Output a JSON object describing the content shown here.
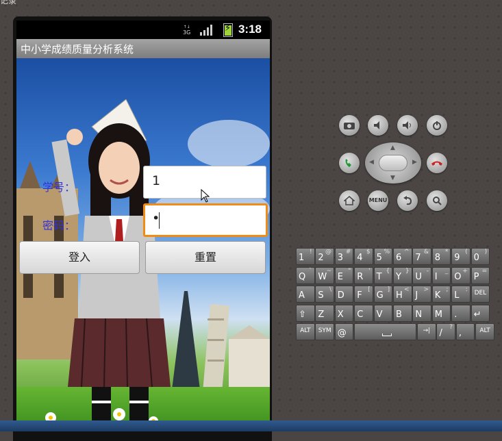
{
  "window": {
    "title": "记录"
  },
  "status_bar": {
    "network": "3G",
    "time": "3:18"
  },
  "app": {
    "title": "中小学成绩质量分析系统"
  },
  "form": {
    "student_id_label": "学号：",
    "student_id_value": "1",
    "password_label": "密码：",
    "password_value": "•",
    "login_button": "登入",
    "reset_button": "重置"
  },
  "controls": {
    "camera": "camera-icon",
    "volume_down": "volume-down-icon",
    "volume_up": "volume-up-icon",
    "power": "power-icon",
    "call": "call-icon",
    "end_call": "end-call-icon",
    "home": "home-icon",
    "menu_label": "MENU",
    "back": "back-icon",
    "search": "search-icon"
  },
  "keyboard": {
    "row1": [
      [
        "1",
        "!"
      ],
      [
        "2",
        "@"
      ],
      [
        "3",
        "#"
      ],
      [
        "4",
        "$"
      ],
      [
        "5",
        "%"
      ],
      [
        "6",
        "^"
      ],
      [
        "7",
        "&"
      ],
      [
        "8",
        "*"
      ],
      [
        "9",
        "("
      ],
      [
        "0",
        ")"
      ]
    ],
    "row2": [
      [
        "Q",
        "`"
      ],
      [
        "W",
        "~"
      ],
      [
        "E",
        "\""
      ],
      [
        "R",
        "'"
      ],
      [
        "T",
        "{"
      ],
      [
        "Y",
        "}"
      ],
      [
        "U",
        "-"
      ],
      [
        "I",
        "_"
      ],
      [
        "O",
        "+"
      ],
      [
        "P",
        "="
      ]
    ],
    "row3": [
      [
        "A",
        ""
      ],
      [
        "S",
        "\\"
      ],
      [
        "D",
        ""
      ],
      [
        "F",
        "["
      ],
      [
        "G",
        "]"
      ],
      [
        "H",
        "<"
      ],
      [
        "J",
        ">"
      ],
      [
        "K",
        ";"
      ],
      [
        "L",
        ":"
      ],
      [
        "DEL",
        ""
      ]
    ],
    "row4": [
      [
        "⇧",
        ""
      ],
      [
        "Z",
        ""
      ],
      [
        "X",
        ""
      ],
      [
        "C",
        ""
      ],
      [
        "V",
        ""
      ],
      [
        "B",
        ""
      ],
      [
        "N",
        ""
      ],
      [
        "M",
        ""
      ],
      [
        ".",
        ""
      ],
      [
        "↵",
        ""
      ]
    ],
    "row5": [
      [
        "ALT",
        ""
      ],
      [
        "SYM",
        ""
      ],
      [
        "@",
        ""
      ],
      [
        "",
        ""
      ],
      [
        "→|",
        ""
      ],
      [
        "/",
        "?"
      ],
      [
        ",",
        ""
      ],
      [
        "ALT",
        ""
      ]
    ]
  }
}
